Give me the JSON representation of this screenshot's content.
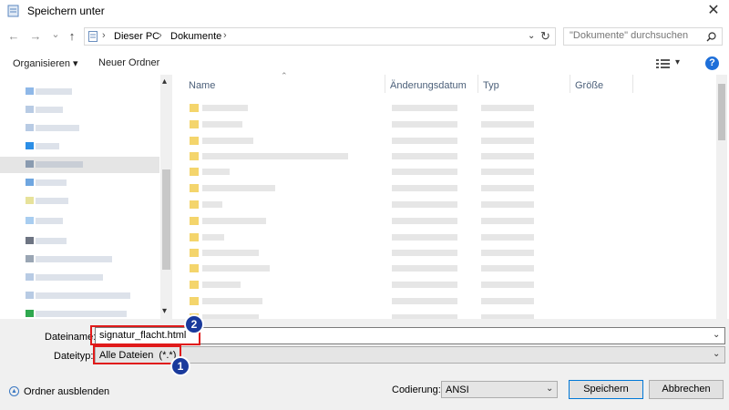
{
  "window": {
    "title": "Speichern unter",
    "close_glyph": "✕"
  },
  "nav_buttons": {
    "back": "←",
    "forward": "→",
    "dropdown": "⌄",
    "up": "↑",
    "refresh": "↻"
  },
  "address": {
    "crumbs": [
      "Dieser PC",
      "Dokumente"
    ],
    "separator": "›"
  },
  "search": {
    "placeholder": "\"Dokumente\" durchsuchen"
  },
  "toolbar": {
    "organize": "Organisieren ▾",
    "new_folder": "Neuer Ordner",
    "help": "?"
  },
  "columns": {
    "name": "Name",
    "date": "Änderungsdatum",
    "type": "Typ",
    "size": "Größe"
  },
  "form": {
    "filename_label": "Dateiname:",
    "filename_value": "signatur_flacht.html",
    "filetype_label": "Dateityp:",
    "filetype_value": "Alle Dateien  (*.*)",
    "hide_folders": "Ordner ausblenden",
    "encoding_label": "Codierung:",
    "encoding_value": "ANSI",
    "save": "Speichern",
    "cancel": "Abbrechen"
  },
  "annotations": {
    "badge_1": "1",
    "badge_2": "2"
  },
  "colors": {
    "accent": "#0078d7",
    "highlight_box": "#e01a1a",
    "badge": "#1a3a9c",
    "folder": "#f4d56c"
  }
}
